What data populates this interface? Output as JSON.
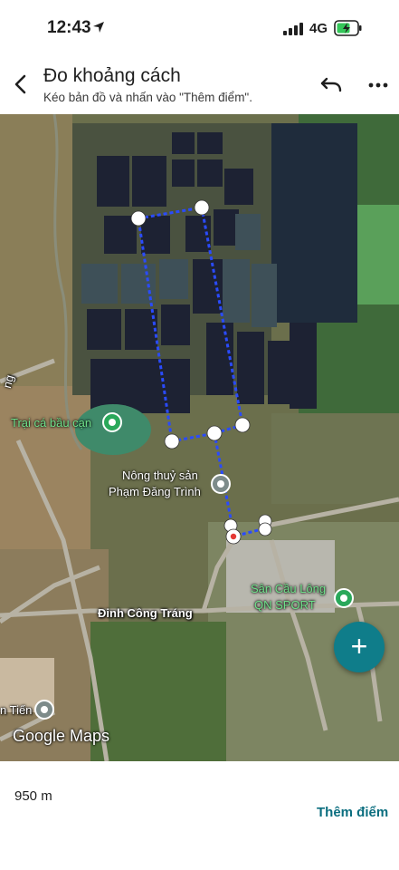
{
  "status_bar": {
    "time": "12:43",
    "network": "4G",
    "icons": [
      "location-arrow-icon",
      "signal-bars-icon",
      "battery-charging-icon"
    ],
    "battery_color": "#34c759"
  },
  "header": {
    "title": "Đo khoảng cách",
    "subtitle": "Kéo bản đồ và nhấn vào \"Thêm điểm\".",
    "icons": [
      "back-arrow-icon",
      "undo-icon",
      "more-vert-icon"
    ]
  },
  "map": {
    "poi": {
      "fish_farm": "Trại cá bầu cạn",
      "agri_line1": "Nông thuỷ sản",
      "agri_line2": "Phạm Đăng Trình",
      "badminton_line1": "Sân Cầu Lông",
      "badminton_line2": "QN SPORT"
    },
    "road_label": "Đinh Công Tráng",
    "edge_labels": {
      "left_edge": "ng",
      "bottom_left": "n Tiến"
    },
    "attribution": "Google Maps",
    "measure_line_color": "#2a4bff"
  },
  "fab": {
    "label": "+"
  },
  "bottom": {
    "distance": "950 m",
    "add_point": "Thêm điểm"
  }
}
